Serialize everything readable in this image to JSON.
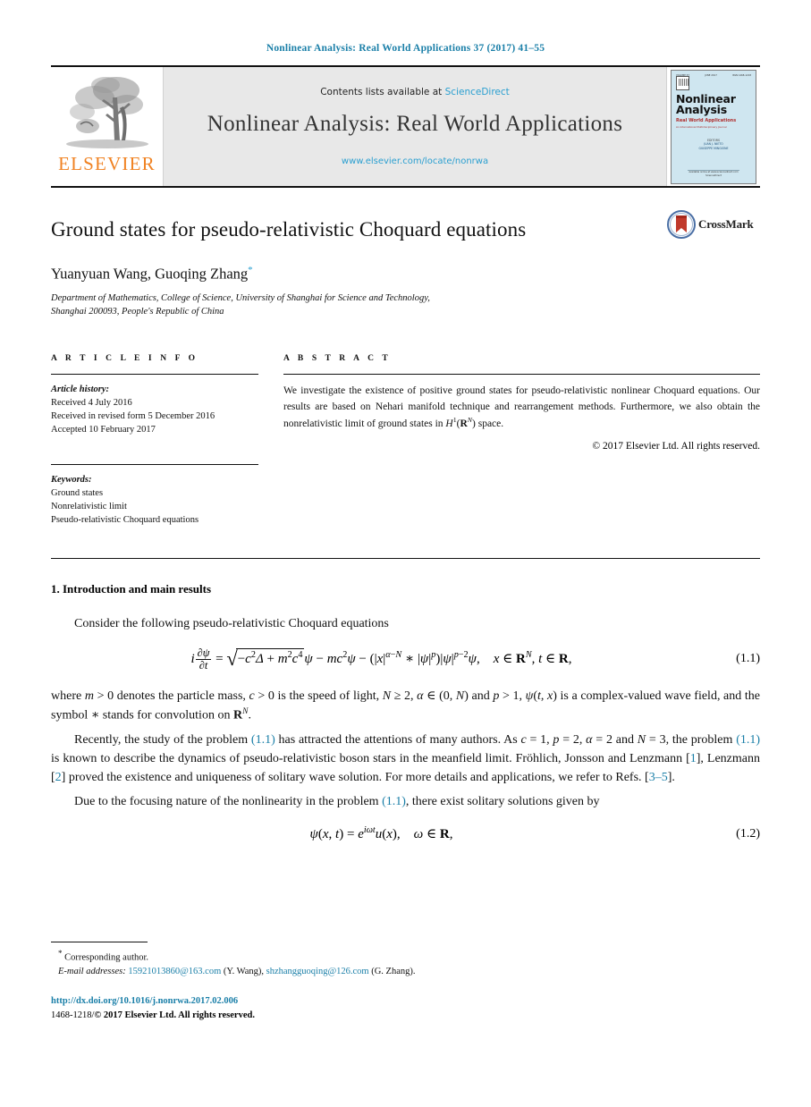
{
  "running_head": "Nonlinear Analysis: Real World Applications 37 (2017) 41–55",
  "masthead": {
    "publisher_logo_text": "ELSEVIER",
    "contents_prefix": "Contents lists available at",
    "contents_link": "ScienceDirect",
    "journal_name": "Nonlinear Analysis: Real World Applications",
    "journal_url": "www.elsevier.com/locate/nonrwa",
    "cover": {
      "volume_label": "VOLUME 37",
      "date_label": "JUNE 2017",
      "issn_label": "ISSN 1468-1218",
      "title_line1": "Nonlinear",
      "title_line2": "Analysis",
      "subtitle": "Real World Applications",
      "subtitle2": "An International Multidisciplinary Journal",
      "editors_label": "EDITORS",
      "editor1": "JUAN J. NIETO",
      "editor2": "GIUSEPPE MINGIONE",
      "footer_line1": "Available online at www.sciencedirect.com",
      "footer_line2": "ScienceDirect"
    }
  },
  "article": {
    "title": "Ground states for pseudo-relativistic Choquard equations",
    "authors": "Yuanyuan Wang, Guoqing Zhang",
    "corresponding_marker": "*",
    "affiliation_line1": "Department of Mathematics, College of Science, University of Shanghai for Science and Technology,",
    "affiliation_line2": "Shanghai 200093, People's Republic of China",
    "crossmark_label": "CrossMark"
  },
  "article_info": {
    "heading": "A R T I C L E   I N F O",
    "history_label": "Article history:",
    "history": [
      "Received 4 July 2016",
      "Received in revised form 5 December 2016",
      "Accepted 10 February 2017"
    ],
    "keywords_label": "Keywords:",
    "keywords": [
      "Ground states",
      "Nonrelativistic limit",
      "Pseudo-relativistic Choquard equations"
    ]
  },
  "abstract": {
    "heading": "A B S T R A C T",
    "text": "We investigate the existence of positive ground states for pseudo-relativistic nonlinear Choquard equations. Our results are based on Nehari manifold technique and rearrangement methods. Furthermore, we also obtain the nonrelativistic limit of ground states in H¹(ℝᴺ) space.",
    "copyright": "© 2017 Elsevier Ltd. All rights reserved."
  },
  "body": {
    "section_heading": "1. Introduction and main results",
    "para1": "Consider the following pseudo-relativistic Choquard equations",
    "eq1_number": "(1.1)",
    "para2_a": "where ",
    "para2_b": " denotes the particle mass, ",
    "para2_c": " is the speed of light, ",
    "para2_d": " and ",
    "para2_e": " is a complex-valued wave field, and the symbol ∗ stands for convolution on ",
    "para3_a": "Recently, the study of the problem ",
    "para3_ref1": "(1.1)",
    "para3_b": " has attracted the attentions of many authors. As ",
    "para3_c": ", the problem ",
    "para3_ref2": "(1.1)",
    "para3_d": " is known to describe the dynamics of pseudo-relativistic boson stars in the meanfield limit. Fröhlich, Jonsson and Lenzmann ",
    "para3_ref3": "1",
    "para3_e": ", Lenzmann ",
    "para3_ref4": "2",
    "para3_f": " proved the existence and uniqueness of solitary wave solution. For more details and applications, we refer to Refs. ",
    "para3_ref5": "3–5",
    "para3_g": ".",
    "para4_a": "Due to the focusing nature of the nonlinearity in the problem ",
    "para4_ref": "(1.1)",
    "para4_b": ", there exist solitary solutions given by",
    "eq2_number": "(1.2)"
  },
  "footnote": {
    "corresponding": "Corresponding author.",
    "email_label": "E-mail addresses:",
    "email1": "15921013860@163.com",
    "email1_author": "(Y. Wang)",
    "email2": "shzhangguoqing@126.com",
    "email2_author": "(G. Zhang)."
  },
  "footer": {
    "doi": "http://dx.doi.org/10.1016/j.nonrwa.2017.02.006",
    "issn_prefix": "1468-1218/",
    "issn_rest": "© 2017 Elsevier Ltd. All rights reserved."
  },
  "colors": {
    "link_blue": "#1a7fa8",
    "sciencedirect_blue": "#2a9fd0",
    "elsevier_orange": "#f08222",
    "masthead_grey": "#e8e8e8",
    "cover_blue": "#cfe6f0"
  }
}
